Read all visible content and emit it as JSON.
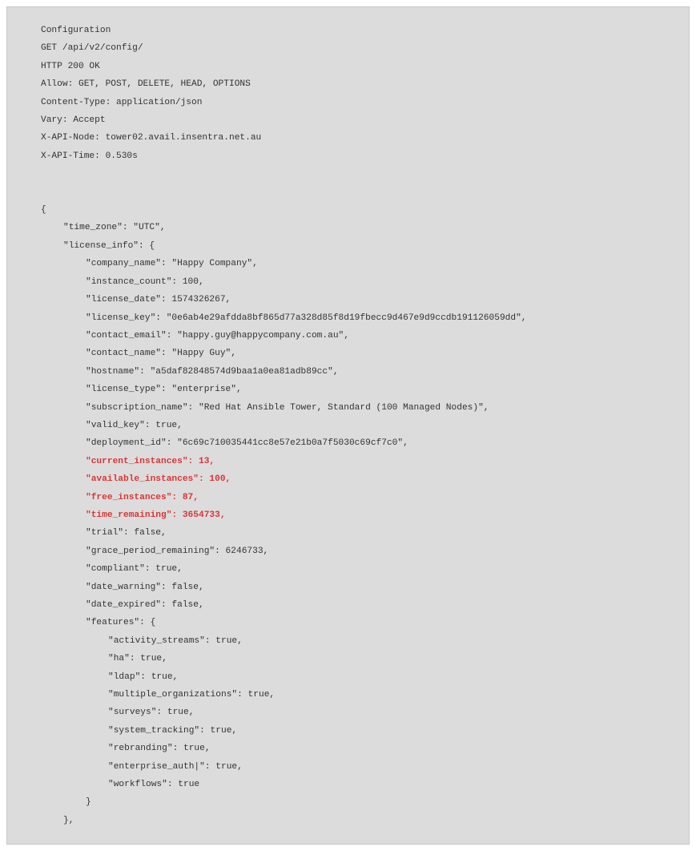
{
  "header": {
    "title": "Configuration",
    "request": "GET /api/v2/config/",
    "status": "HTTP 200 OK",
    "allow": "Allow: GET, POST, DELETE, HEAD, OPTIONS",
    "content_type": "Content-Type: application/json",
    "vary": "Vary: Accept",
    "api_node": "X-API-Node: tower02.avail.insentra.net.au",
    "api_time": "X-API-Time: 0.530s"
  },
  "json": {
    "open_brace": "{",
    "time_zone": "\"time_zone\": \"UTC\",",
    "license_info_open": "\"license_info\": {",
    "company_name": "\"company_name\": \"Happy Company\",",
    "instance_count": "\"instance_count\": 100,",
    "license_date": "\"license_date\": 1574326267,",
    "license_key": "\"license_key\": \"0e6ab4e29afdda8bf865d77a328d85f8d19fbecc9d467e9d9ccdb191126059dd\",",
    "contact_email": "\"contact_email\": \"happy.guy@happycompany.com.au\",",
    "contact_name": "\"contact_name\": \"Happy Guy\",",
    "hostname": "\"hostname\": \"a5daf82848574d9baa1a0ea81adb89cc\",",
    "license_type": "\"license_type\": \"enterprise\",",
    "subscription_name": "\"subscription_name\": \"Red Hat Ansible Tower, Standard (100 Managed Nodes)\",",
    "valid_key": "\"valid_key\": true,",
    "deployment_id": "\"deployment_id\": \"6c69c710035441cc8e57e21b0a7f5030c69cf7c0\",",
    "current_instances": "\"current_instances\": 13,",
    "available_instances": "\"available_instances\": 100,",
    "free_instances": "\"free_instances\": 87,",
    "time_remaining": "\"time_remaining\": 3654733,",
    "trial": "\"trial\": false,",
    "grace_period_remaining": "\"grace_period_remaining\": 6246733,",
    "compliant": "\"compliant\": true,",
    "date_warning": "\"date_warning\": false,",
    "date_expired": "\"date_expired\": false,",
    "features_open": "\"features\": {",
    "activity_streams": "\"activity_streams\": true,",
    "ha": "\"ha\": true,",
    "ldap": "\"ldap\": true,",
    "multiple_organizations": "\"multiple_organizations\": true,",
    "surveys": "\"surveys\": true,",
    "system_tracking": "\"system_tracking\": true,",
    "rebranding": "\"rebranding\": true,",
    "enterprise_auth": "\"enterprise_auth|\": true,",
    "workflows": "\"workflows\": true",
    "features_close": "}",
    "license_info_close": "},"
  }
}
